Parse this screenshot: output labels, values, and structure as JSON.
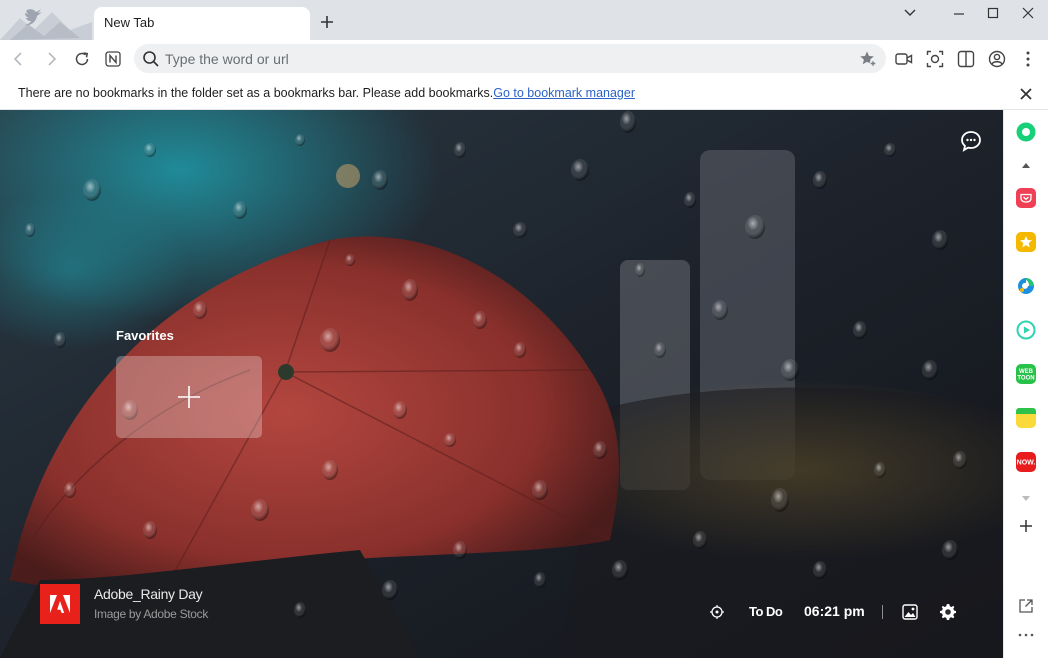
{
  "tab": {
    "title": "New Tab"
  },
  "omnibox": {
    "placeholder": "Type the word or url"
  },
  "bookmarks_bar": {
    "message": "There are no bookmarks in the folder set as a bookmarks bar. Please add bookmarks.",
    "link": "Go to bookmark manager"
  },
  "favorites": {
    "title": "Favorites"
  },
  "background": {
    "title": "Adobe_Rainy Day",
    "credit": "Image by Adobe Stock"
  },
  "bottom_bar": {
    "todo_label": "To Do",
    "time": "06:21 pm"
  },
  "sidebar": {
    "items": [
      {
        "icon": "circle-icon",
        "color": "#19d07a"
      },
      {
        "icon": "pocket-icon",
        "color": "#ef4056"
      },
      {
        "icon": "star-icon",
        "color": "#f5b800"
      },
      {
        "icon": "edge-icon",
        "color": "#1c8fe0"
      },
      {
        "icon": "play-icon",
        "color": "#2ed3b0"
      },
      {
        "icon": "webtoon-icon",
        "color": "#28c24b",
        "label": "WEB TOON"
      },
      {
        "icon": "memo-icon",
        "color": "#fad93a"
      },
      {
        "icon": "now-icon",
        "color": "#e81c1c",
        "label": "NOW."
      }
    ]
  },
  "colors": {
    "accent": "#2b63c9",
    "adobe_red": "#e8221b",
    "umbrella": "#9b3a35"
  }
}
